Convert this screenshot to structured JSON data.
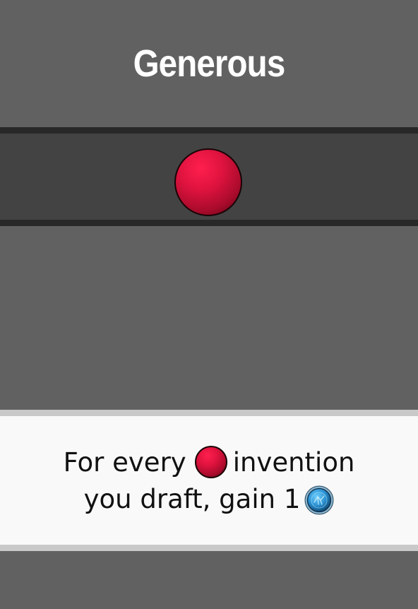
{
  "card": {
    "title": "Generous",
    "ability": {
      "line1_before": "For every",
      "line1_after": "invention",
      "line2_text": "you draft, gain 1"
    }
  },
  "icons": {
    "large_gem": "red-gem-icon",
    "inline_gem": "red-gem-icon",
    "reward_token": "blue-token-icon"
  },
  "colors": {
    "background": "#616161",
    "band_dark": "#282828",
    "band": "#434343",
    "gem_red": "#e0133f",
    "panel": "#f9f9f9",
    "panel_border": "#c9c9c9",
    "token_blue": "#2a8fd0"
  }
}
